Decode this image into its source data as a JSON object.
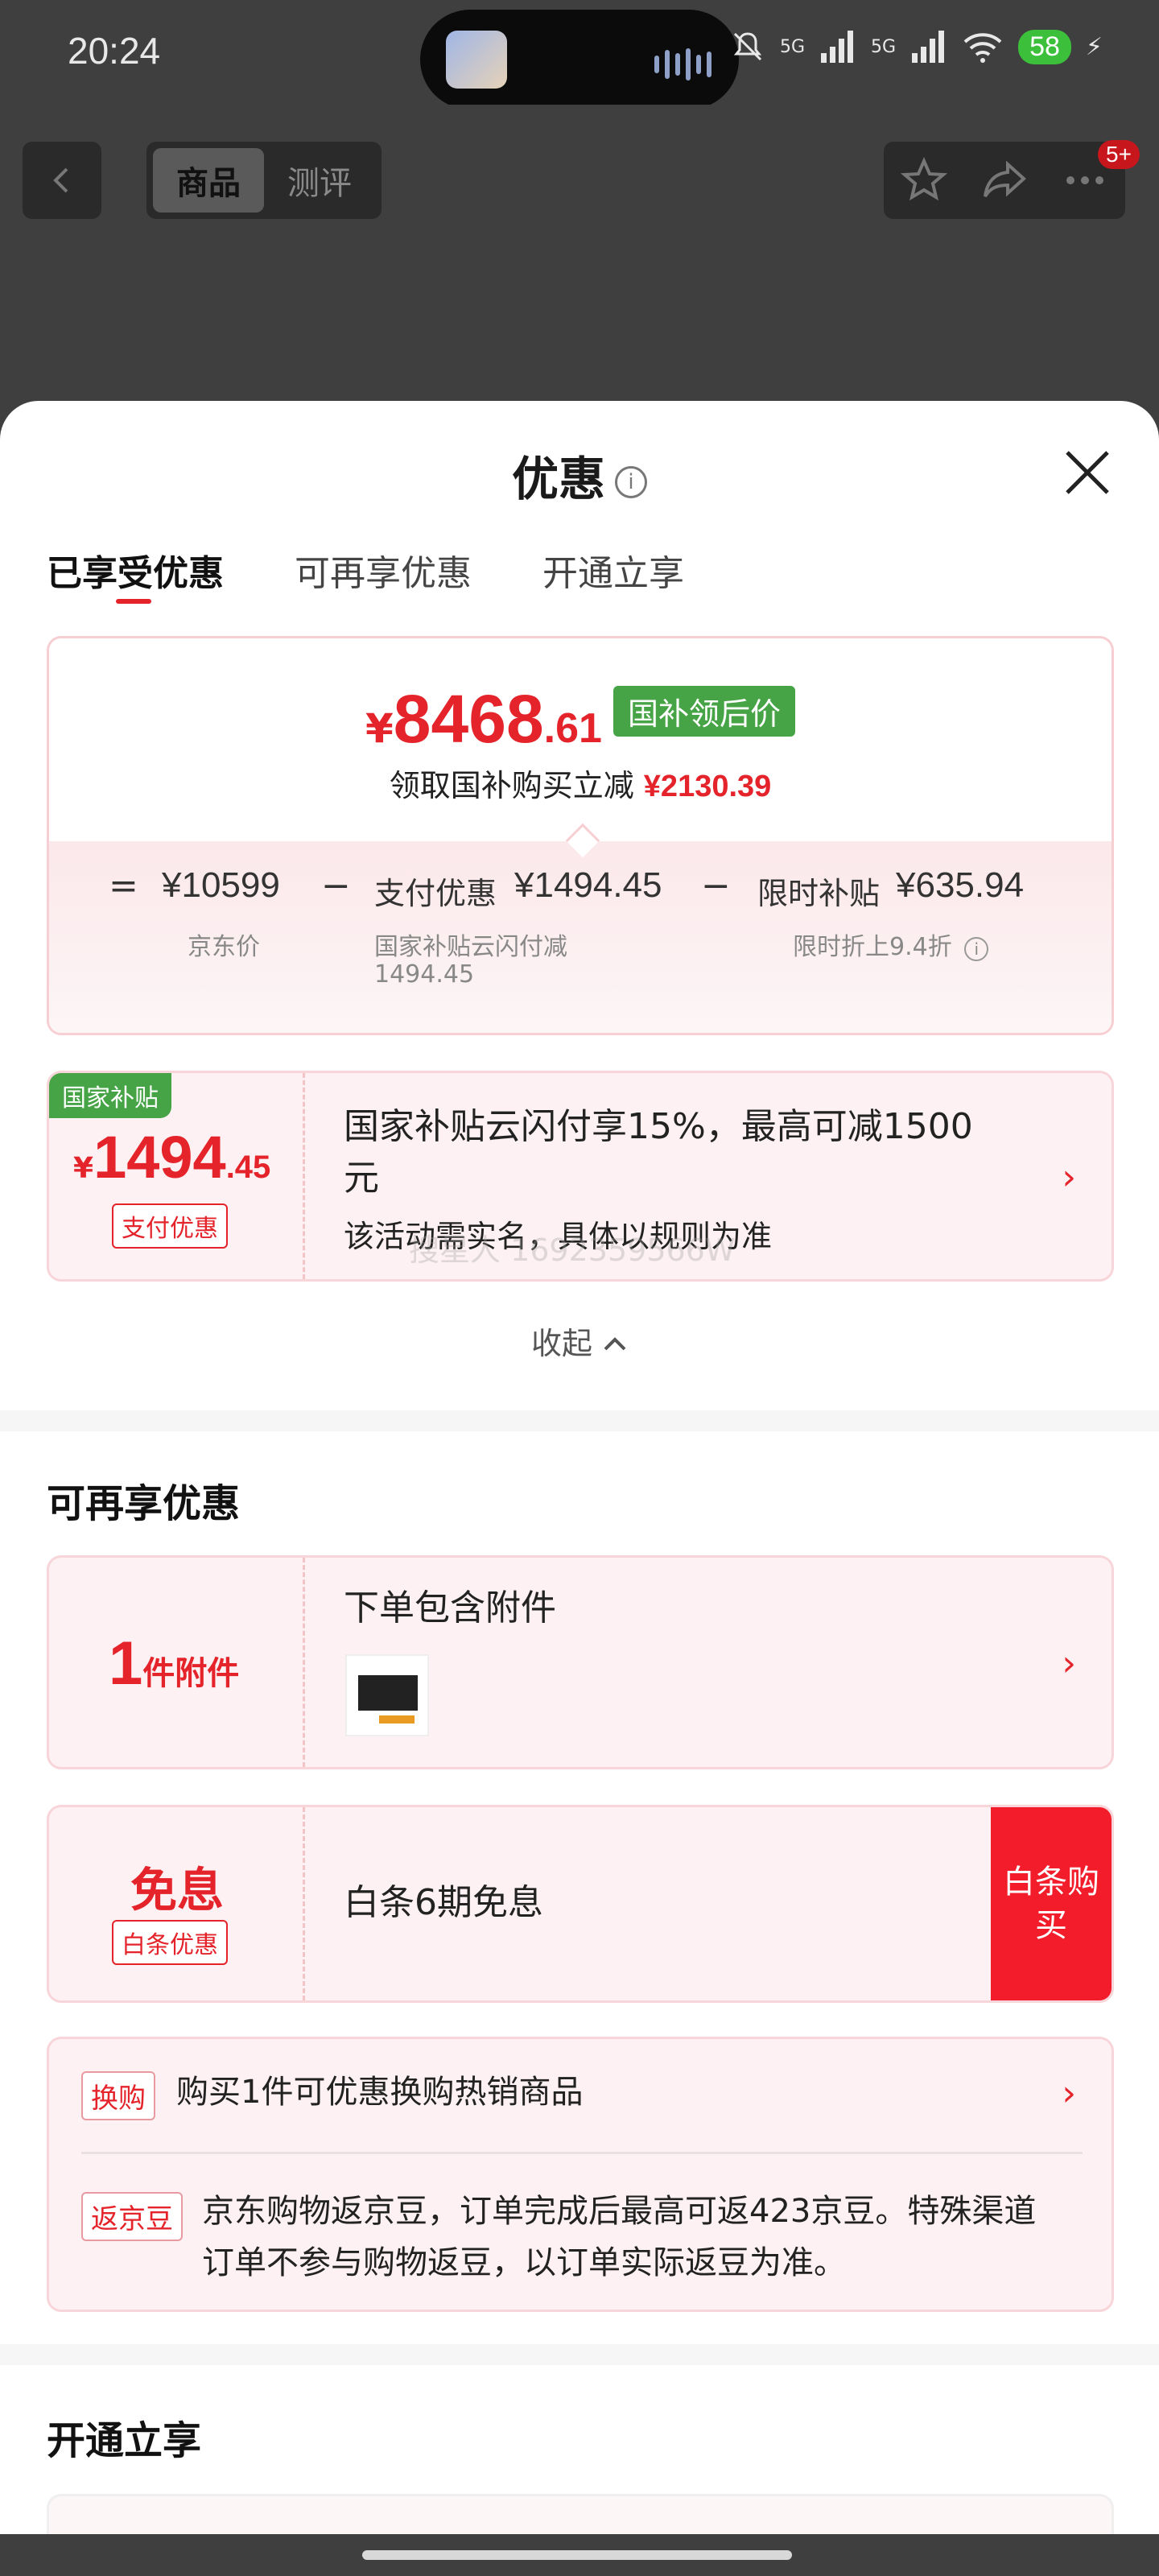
{
  "status_bar": {
    "time": "20:24",
    "battery": "58",
    "network_1": "5G",
    "network_2": "5G"
  },
  "header": {
    "tabs": [
      "商品",
      "测评"
    ],
    "active_tab": 0,
    "badge": "5+"
  },
  "sheet": {
    "title": "优惠",
    "tabs": [
      "已享受优惠",
      "可再享优惠",
      "开通立享"
    ],
    "active_tab": 0
  },
  "price_card": {
    "currency": "¥",
    "price_int": "8468",
    "price_dec": ".61",
    "price_tag": "国补领后价",
    "subtitle_prefix": "领取国补购买立减",
    "subtitle_amount": "¥2130.39",
    "formula": {
      "eq": "=",
      "jd_price": "¥10599",
      "minus": "−",
      "pay_discount_label": "支付优惠",
      "pay_discount": "¥1494.45",
      "limit_label": "限时补贴",
      "limit_amount": "¥635.94"
    },
    "labels": {
      "jd_price": "京东价",
      "pay_desc_1": "国家补贴云闪付减",
      "pay_desc_2": "1494.45",
      "limit_desc": "限时折上9.4折"
    }
  },
  "subsidy_coupon": {
    "tag": "国家补贴",
    "currency": "¥",
    "amount_int": "1494",
    "amount_dec": ".45",
    "type": "支付优惠",
    "title_line1": "国家补贴云闪付享15%，最高可减1500",
    "title_line2": "元",
    "subtitle": "该活动需实名，具体以规则为准"
  },
  "watermark": "搜星人 1692359566W",
  "collapse_label": "收起",
  "more_section": {
    "title": "可再享优惠",
    "accessory": {
      "count": "1",
      "unit": "件附件",
      "title": "下单包含附件"
    },
    "interest_free": {
      "label": "免息",
      "tag": "白条优惠",
      "title": "白条6期免息",
      "button": "白条购买"
    }
  },
  "promos": [
    {
      "tag": "换购",
      "text": "购买1件可优惠换购热销商品"
    },
    {
      "tag": "返京豆",
      "text_line1": "京东购物返京豆，订单完成后最高可返423京豆。特殊渠道",
      "text_line2": "订单不参与购物返豆，以订单实际返豆为准。"
    }
  ],
  "open_section": {
    "title": "开通立享"
  },
  "colors": {
    "accent": "#e4232b",
    "green": "#46a446",
    "overlay": "#3f3f3f"
  }
}
